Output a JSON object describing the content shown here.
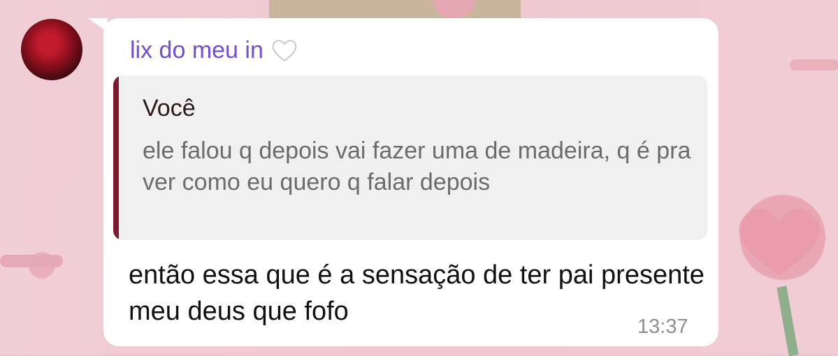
{
  "chat": {
    "sender_name": "lix do meu in",
    "sender_emoji": "white-heart-icon",
    "reply": {
      "author": "Você",
      "text": "ele falou q depois vai fazer uma de madeira, q é pra ver como eu quero q falar depois"
    },
    "message": "então essa que é a sensação de ter pai presente meu deus que fofo",
    "time": "13:37"
  },
  "colors": {
    "sender_name": "#6e4fd6",
    "reply_bar": "#7a1a2c",
    "bubble": "#ffffff",
    "background": "#eec7cf"
  }
}
